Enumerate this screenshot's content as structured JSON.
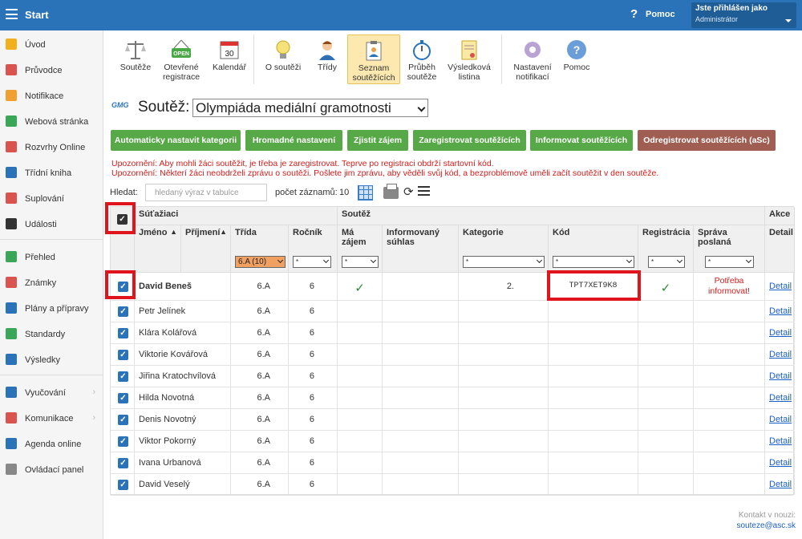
{
  "topbar": {
    "menu_icon": "hamburger-icon",
    "title": "Start",
    "help_icon": "?",
    "help_label": "Pomoc",
    "user_title": "Jste přihlášen jako",
    "user_role": "Administrátor"
  },
  "sidebar": {
    "items": [
      {
        "label": "Úvod",
        "icon": "star-icon",
        "color": "#f2b01e"
      },
      {
        "label": "Průvodce",
        "icon": "wand-icon",
        "color": "#d9534f"
      },
      {
        "label": "Notifikace",
        "icon": "envelope-icon",
        "color": "#f0a030"
      },
      {
        "label": "Webová stránka",
        "icon": "house-icon",
        "color": "#3aa657"
      },
      {
        "label": "Rozvrhy Online",
        "icon": "timetable-icon",
        "color": "#d9534f"
      },
      {
        "label": "Třídní kniha",
        "icon": "book-icon",
        "color": "#2b73b8"
      },
      {
        "label": "Suplování",
        "icon": "person-icon",
        "color": "#d9534f"
      },
      {
        "label": "Události",
        "icon": "event-icon",
        "color": "#333333"
      },
      {
        "label": "Přehled",
        "icon": "check-circle-icon",
        "color": "#3aa657"
      },
      {
        "label": "Známky",
        "icon": "grades-icon",
        "color": "#d9534f"
      },
      {
        "label": "Plány a přípravy",
        "icon": "plans-icon",
        "color": "#2b73b8"
      },
      {
        "label": "Standardy",
        "icon": "shield-icon",
        "color": "#3aa657"
      },
      {
        "label": "Výsledky",
        "icon": "bar-chart-icon",
        "color": "#2b73b8"
      },
      {
        "label": "Vyučování",
        "icon": "teaching-icon",
        "color": "#2b73b8"
      },
      {
        "label": "Komunikace",
        "icon": "chat-icon",
        "color": "#d9534f"
      },
      {
        "label": "Agenda online",
        "icon": "pen-icon",
        "color": "#2b73b8"
      },
      {
        "label": "Ovládací panel",
        "icon": "gear-icon",
        "color": "#888888"
      }
    ]
  },
  "toolbar": {
    "buttons": [
      {
        "label": "Soutěže",
        "icon": "scales-icon"
      },
      {
        "label": "Otevřené\nregistrace",
        "icon": "open-sign-icon",
        "sign": "OPEN"
      },
      {
        "label": "Kalendář",
        "icon": "calendar-icon",
        "day": "30"
      },
      {
        "label": "O soutěži",
        "icon": "lightbulb-icon"
      },
      {
        "label": "Třídy",
        "icon": "student-icon"
      },
      {
        "label": "Seznam\nsoutěžících",
        "icon": "clipboard-icon"
      },
      {
        "label": "Průběh\nsoutěže",
        "icon": "stopwatch-icon"
      },
      {
        "label": "Výsledková\nlistina",
        "icon": "certificate-icon"
      },
      {
        "label": "Nastavení\nnotifikací",
        "icon": "settings-icon"
      },
      {
        "label": "Pomoc",
        "icon": "help-icon"
      }
    ]
  },
  "contest": {
    "logo_text": "GMG",
    "label": "Soutěž:",
    "selected": "Olympiáda mediální gramotnosti"
  },
  "actions": {
    "auto_category": "Automaticky nastavit kategorii",
    "bulk_settings": "Hromadné nastavení",
    "find_interest": "Zjistit zájem",
    "register": "Zaregistrovat soutěžících",
    "inform": "Informovat soutěžících",
    "unregister": "Odregistrovat soutěžících (aSc)"
  },
  "warnings": [
    "Upozornění: Aby mohli žáci soutěžit, je třeba je zaregistrovat. Teprve po registraci obdrží startovní kód.",
    "Upozornění: Některí žáci neobdrželi zprávu o soutěži. Pošlete jim zprávu, aby věděli svůj kód, a bezproblémově uměli začít soutěžit v den soutěže."
  ],
  "search": {
    "label": "Hledat:",
    "placeholder": "hledaný výraz v tabulce",
    "count_label": "počet záznamů:",
    "count": "10"
  },
  "table": {
    "group_participants": "Súťažiaci",
    "group_contest": "Soutěž",
    "group_actions": "Akce",
    "col_name": "Jméno",
    "col_surname": "Příjmení",
    "col_class": "Třída",
    "col_year": "Ročník",
    "col_interest": "Má\nzájem",
    "col_consent": "Informovaný\nsúhlas",
    "col_category": "Kategorie",
    "col_code": "Kód",
    "col_registration": "Registrácia",
    "col_message": "Správa\nposlaná",
    "col_detail": "Detail",
    "sort_icon": "▲",
    "filter_class": "6.A (10)",
    "filter_any": "*",
    "rows": [
      {
        "name": "David Beneš",
        "class": "6.A",
        "year": "6",
        "interest": "✓",
        "category": "2.",
        "code": "TPT7XET9K8",
        "registration": "✓",
        "message": "Potřeba informovat!",
        "detail": "Detail"
      },
      {
        "name": "Petr Jelínek",
        "class": "6.A",
        "year": "6",
        "interest": "",
        "category": "",
        "code": "",
        "registration": "",
        "message": "",
        "detail": "Detail"
      },
      {
        "name": "Klára Kolářová",
        "class": "6.A",
        "year": "6",
        "interest": "",
        "category": "",
        "code": "",
        "registration": "",
        "message": "",
        "detail": "Detail"
      },
      {
        "name": "Viktorie Kovářová",
        "class": "6.A",
        "year": "6",
        "interest": "",
        "category": "",
        "code": "",
        "registration": "",
        "message": "",
        "detail": "Detail"
      },
      {
        "name": "Jiřina Kratochvílová",
        "class": "6.A",
        "year": "6",
        "interest": "",
        "category": "",
        "code": "",
        "registration": "",
        "message": "",
        "detail": "Detail"
      },
      {
        "name": "Hilda Novotná",
        "class": "6.A",
        "year": "6",
        "interest": "",
        "category": "",
        "code": "",
        "registration": "",
        "message": "",
        "detail": "Detail"
      },
      {
        "name": "Denis Novotný",
        "class": "6.A",
        "year": "6",
        "interest": "",
        "category": "",
        "code": "",
        "registration": "",
        "message": "",
        "detail": "Detail"
      },
      {
        "name": "Viktor Pokorný",
        "class": "6.A",
        "year": "6",
        "interest": "",
        "category": "",
        "code": "",
        "registration": "",
        "message": "",
        "detail": "Detail"
      },
      {
        "name": "Ivana Urbanová",
        "class": "6.A",
        "year": "6",
        "interest": "",
        "category": "",
        "code": "",
        "registration": "",
        "message": "",
        "detail": "Detail"
      },
      {
        "name": "David Veselý",
        "class": "6.A",
        "year": "6",
        "interest": "",
        "category": "",
        "code": "",
        "registration": "",
        "message": "",
        "detail": "Detail"
      }
    ]
  },
  "footer": {
    "contact_label": "Kontakt v nouzi:",
    "email": "souteze@asc.sk"
  },
  "colors": {
    "accent": "#2b73b8",
    "green_button": "#57a846",
    "brown_button": "#a05e52",
    "warning": "#d51c1c",
    "highlight": "#e0141c"
  }
}
